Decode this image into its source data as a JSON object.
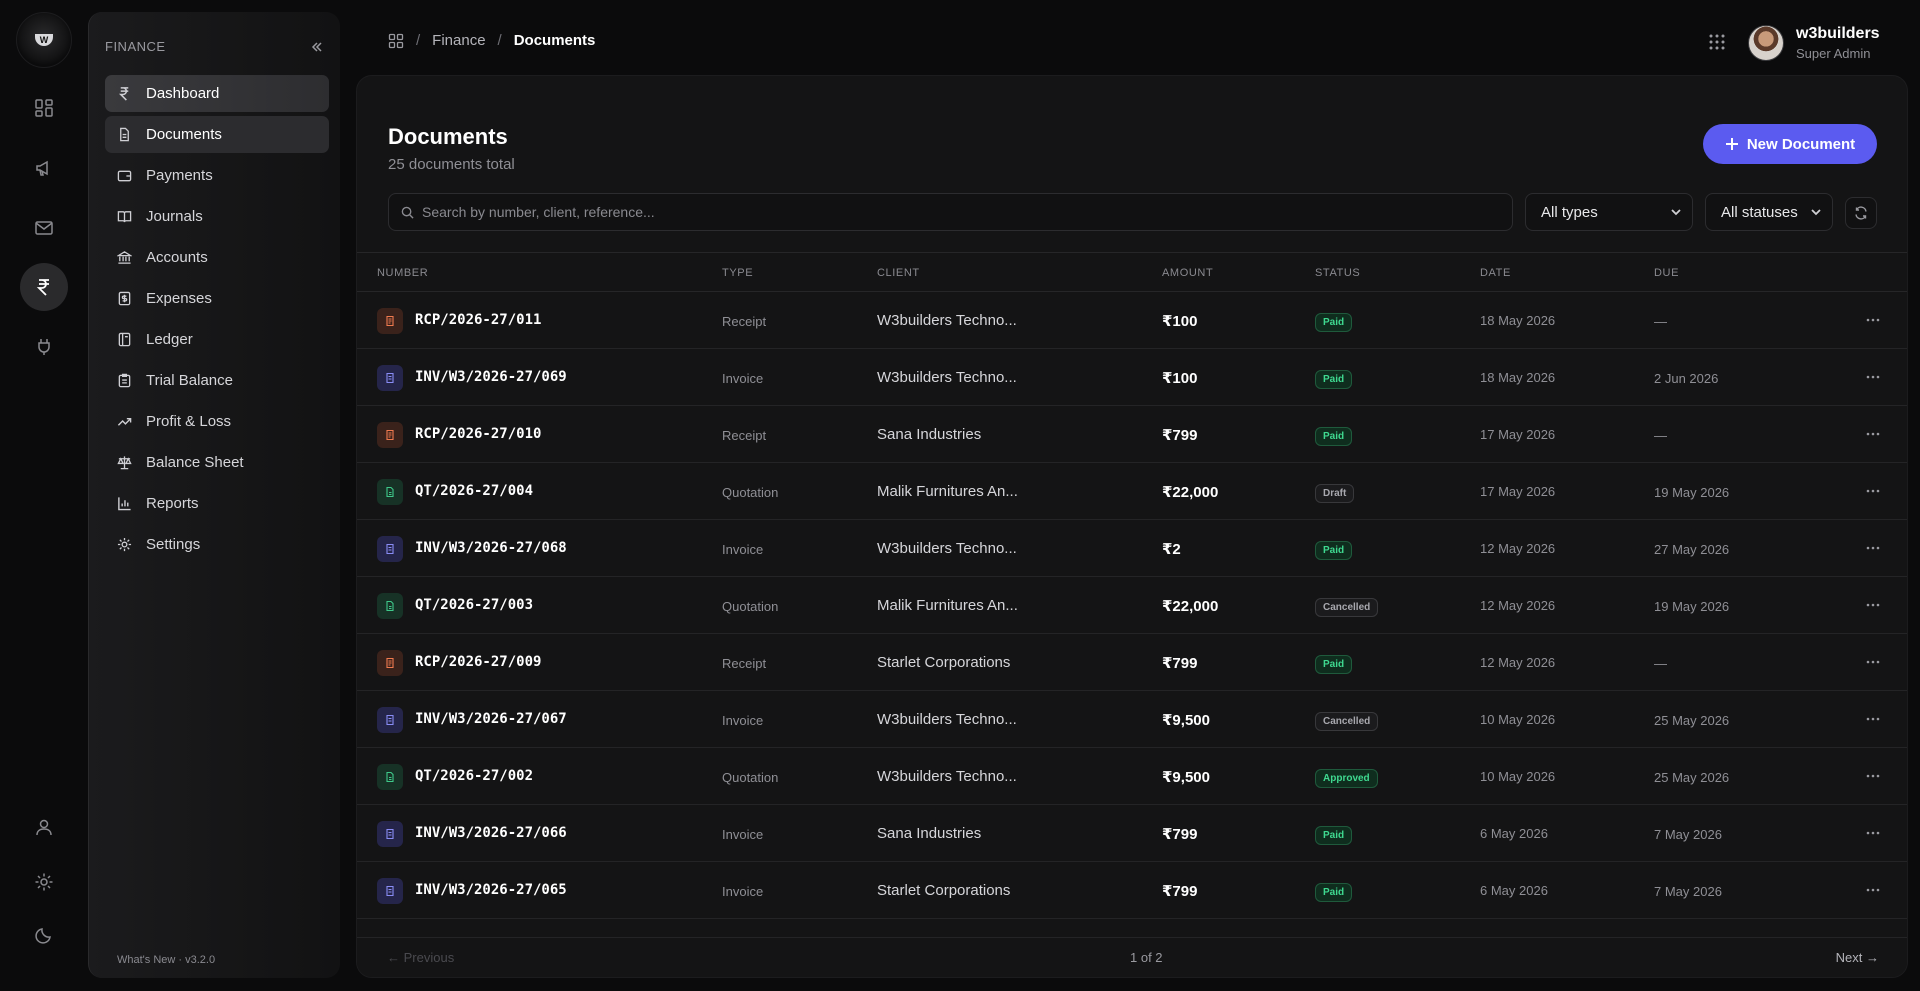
{
  "rail": {
    "logo_letter": "W",
    "items": [
      "dashboard-grid",
      "megaphone",
      "mail",
      "rupee",
      "plug"
    ],
    "bottom": [
      "user",
      "settings",
      "moon"
    ]
  },
  "sidebar": {
    "section_title": "FINANCE",
    "items": [
      {
        "label": "Dashboard",
        "icon": "rupee-icon"
      },
      {
        "label": "Documents",
        "icon": "document-icon"
      },
      {
        "label": "Payments",
        "icon": "wallet-icon"
      },
      {
        "label": "Journals",
        "icon": "book-icon"
      },
      {
        "label": "Accounts",
        "icon": "bank-icon"
      },
      {
        "label": "Expenses",
        "icon": "receipt-icon"
      },
      {
        "label": "Ledger",
        "icon": "ledger-icon"
      },
      {
        "label": "Trial Balance",
        "icon": "clipboard-icon"
      },
      {
        "label": "Profit & Loss",
        "icon": "trend-icon"
      },
      {
        "label": "Balance Sheet",
        "icon": "scale-icon"
      },
      {
        "label": "Reports",
        "icon": "bar-chart-icon"
      },
      {
        "label": "Settings",
        "icon": "gear-icon"
      }
    ],
    "footer": "What's New · v3.2.0"
  },
  "header": {
    "breadcrumb": [
      "Finance",
      "Documents"
    ],
    "user_name": "w3builders",
    "user_role": "Super Admin"
  },
  "main": {
    "title": "Documents",
    "subtitle": "25 documents total",
    "new_button": "New Document",
    "search_placeholder": "Search by number, client, reference...",
    "type_filter": "All types",
    "status_filter": "All statuses",
    "columns": [
      "NUMBER",
      "TYPE",
      "CLIENT",
      "AMOUNT",
      "STATUS",
      "DATE",
      "DUE"
    ],
    "rows": [
      {
        "number": "RCP/2026-27/011",
        "type": "Receipt",
        "client": "W3builders Techno...",
        "amount": "₹100",
        "status": "Paid",
        "date": "18 May 2026",
        "due": "—"
      },
      {
        "number": "INV/W3/2026-27/069",
        "type": "Invoice",
        "client": "W3builders Techno...",
        "amount": "₹100",
        "status": "Paid",
        "date": "18 May 2026",
        "due": "2 Jun 2026"
      },
      {
        "number": "RCP/2026-27/010",
        "type": "Receipt",
        "client": "Sana Industries",
        "amount": "₹799",
        "status": "Paid",
        "date": "17 May 2026",
        "due": "—"
      },
      {
        "number": "QT/2026-27/004",
        "type": "Quotation",
        "client": "Malik Furnitures An...",
        "amount": "₹22,000",
        "status": "Draft",
        "date": "17 May 2026",
        "due": "19 May 2026"
      },
      {
        "number": "INV/W3/2026-27/068",
        "type": "Invoice",
        "client": "W3builders Techno...",
        "amount": "₹2",
        "status": "Paid",
        "date": "12 May 2026",
        "due": "27 May 2026"
      },
      {
        "number": "QT/2026-27/003",
        "type": "Quotation",
        "client": "Malik Furnitures An...",
        "amount": "₹22,000",
        "status": "Cancelled",
        "date": "12 May 2026",
        "due": "19 May 2026"
      },
      {
        "number": "RCP/2026-27/009",
        "type": "Receipt",
        "client": "Starlet Corporations",
        "amount": "₹799",
        "status": "Paid",
        "date": "12 May 2026",
        "due": "—"
      },
      {
        "number": "INV/W3/2026-27/067",
        "type": "Invoice",
        "client": "W3builders Techno...",
        "amount": "₹9,500",
        "status": "Cancelled",
        "date": "10 May 2026",
        "due": "25 May 2026"
      },
      {
        "number": "QT/2026-27/002",
        "type": "Quotation",
        "client": "W3builders Techno...",
        "amount": "₹9,500",
        "status": "Approved",
        "date": "10 May 2026",
        "due": "25 May 2026"
      },
      {
        "number": "INV/W3/2026-27/066",
        "type": "Invoice",
        "client": "Sana Industries",
        "amount": "₹799",
        "status": "Paid",
        "date": "6 May 2026",
        "due": "7 May 2026"
      },
      {
        "number": "INV/W3/2026-27/065",
        "type": "Invoice",
        "client": "Starlet Corporations",
        "amount": "₹799",
        "status": "Paid",
        "date": "6 May 2026",
        "due": "7 May 2026"
      }
    ],
    "pagination": {
      "prev": "← Previous",
      "page": "1 of 2",
      "next": "Next →"
    }
  },
  "colors": {
    "accent": "#5b5bf0",
    "paid": "#3fd990",
    "receipt_icon": "#f07b4f",
    "invoice_icon": "#8a8cf5",
    "quotation_icon": "#3fc98a"
  }
}
